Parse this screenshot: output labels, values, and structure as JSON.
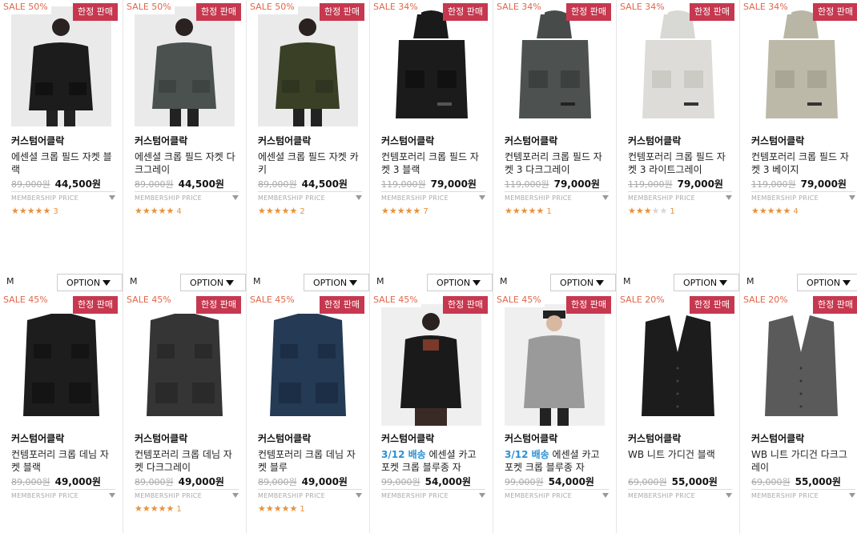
{
  "products": [
    {
      "sale": "SALE 50%",
      "limited": "한정 판매",
      "brand": "커스텀어클락",
      "name": "에센셜 크롭 필드 자켓 블랙",
      "ship": "",
      "orig": "89,000원",
      "price": "44,500원",
      "member": "MEMBERSHIP PRICE",
      "stars": "★★★★★",
      "stars_off": "",
      "count": "3",
      "size": "M",
      "option": "OPTION"
    },
    {
      "sale": "SALE 50%",
      "limited": "한정 판매",
      "brand": "커스텀어클락",
      "name": "에센셜 크롭 필드 자켓 다크그레이",
      "ship": "",
      "orig": "89,000원",
      "price": "44,500원",
      "member": "MEMBERSHIP PRICE",
      "stars": "★★★★★",
      "stars_off": "",
      "count": "4",
      "size": "M",
      "option": "OPTION"
    },
    {
      "sale": "SALE 50%",
      "limited": "한정 판매",
      "brand": "커스텀어클락",
      "name": "에센셜 크롭 필드 자켓 카키",
      "ship": "",
      "orig": "89,000원",
      "price": "44,500원",
      "member": "MEMBERSHIP PRICE",
      "stars": "★★★★★",
      "stars_off": "",
      "count": "2",
      "size": "M",
      "option": "OPTION"
    },
    {
      "sale": "SALE 34%",
      "limited": "한정 판매",
      "brand": "커스텀어클락",
      "name": "컨템포러리 크롭 필드 자켓 3 블랙",
      "ship": "",
      "orig": "119,000원",
      "price": "79,000원",
      "member": "MEMBERSHIP PRICE",
      "stars": "★★★★★",
      "stars_off": "",
      "count": "7",
      "size": "M",
      "option": "OPTION"
    },
    {
      "sale": "SALE 34%",
      "limited": "한정 판매",
      "brand": "커스텀어클락",
      "name": "컨템포러리 크롭 필드 자켓 3 다크그레이",
      "ship": "",
      "orig": "119,000원",
      "price": "79,000원",
      "member": "MEMBERSHIP PRICE",
      "stars": "★★★★★",
      "stars_off": "",
      "count": "1",
      "size": "M",
      "option": "OPTION"
    },
    {
      "sale": "SALE 34%",
      "limited": "한정 판매",
      "brand": "커스텀어클락",
      "name": "컨템포러리 크롭 필드 자켓 3 라이트그레이",
      "ship": "",
      "orig": "119,000원",
      "price": "79,000원",
      "member": "MEMBERSHIP PRICE",
      "stars": "★★★",
      "stars_off": "★★",
      "count": "1",
      "size": "M",
      "option": "OPTION"
    },
    {
      "sale": "SALE 34%",
      "limited": "한정 판매",
      "brand": "커스텀어클락",
      "name": "컨템포러리 크롭 필드 자켓 3 베이지",
      "ship": "",
      "orig": "119,000원",
      "price": "79,000원",
      "member": "MEMBERSHIP PRICE",
      "stars": "★★★★★",
      "stars_off": "",
      "count": "4",
      "size": "M",
      "option": "OPTION"
    },
    {
      "sale": "SALE 45%",
      "limited": "한정 판매",
      "brand": "커스텀어클락",
      "name": "컨템포러리 크롭 데님 자켓 블랙",
      "ship": "",
      "orig": "89,000원",
      "price": "49,000원",
      "member": "MEMBERSHIP PRICE",
      "stars": "",
      "stars_off": "",
      "count": ""
    },
    {
      "sale": "SALE 45%",
      "limited": "한정 판매",
      "brand": "커스텀어클락",
      "name": "컨템포러리 크롭 데님 자켓 다크그레이",
      "ship": "",
      "orig": "89,000원",
      "price": "49,000원",
      "member": "MEMBERSHIP PRICE",
      "stars": "★★★★★",
      "stars_off": "",
      "count": "1"
    },
    {
      "sale": "SALE 45%",
      "limited": "한정 판매",
      "brand": "커스텀어클락",
      "name": "컨템포러리 크롭 데님 자켓 블루",
      "ship": "",
      "orig": "89,000원",
      "price": "49,000원",
      "member": "MEMBERSHIP PRICE",
      "stars": "★★★★★",
      "stars_off": "",
      "count": "1"
    },
    {
      "sale": "SALE 45%",
      "limited": "한정 판매",
      "brand": "커스텀어클락",
      "name": "에센셜 카고 포켓 크롭 블루종 자",
      "ship": "3/12 배송",
      "orig": "99,000원",
      "price": "54,000원",
      "member": "MEMBERSHIP PRICE",
      "stars": "",
      "stars_off": "",
      "count": ""
    },
    {
      "sale": "SALE 45%",
      "limited": "한정 판매",
      "brand": "커스텀어클락",
      "name": "에센셜 카고 포켓 크롭 블루종 자",
      "ship": "3/12 배송",
      "orig": "99,000원",
      "price": "54,000원",
      "member": "MEMBERSHIP PRICE",
      "stars": "",
      "stars_off": "",
      "count": ""
    },
    {
      "sale": "SALE 20%",
      "limited": "한정 판매",
      "brand": "커스텀어클락",
      "name": "WB 니트 가디건 블랙",
      "ship": "",
      "orig": "69,000원",
      "price": "55,000원",
      "member": "MEMBERSHIP PRICE",
      "stars": "",
      "stars_off": "",
      "count": ""
    },
    {
      "sale": "SALE 20%",
      "limited": "한정 판매",
      "brand": "커스텀어클락",
      "name": "WB 니트 가디건 다크그레이",
      "ship": "",
      "orig": "69,000원",
      "price": "55,000원",
      "member": "MEMBERSHIP PRICE",
      "stars": "",
      "stars_off": "",
      "count": ""
    }
  ],
  "colors": {
    "sale_text": "#e0664a",
    "limited_bg": "#c6384f",
    "star": "#e8913a",
    "ship_text": "#2a8fd4"
  }
}
